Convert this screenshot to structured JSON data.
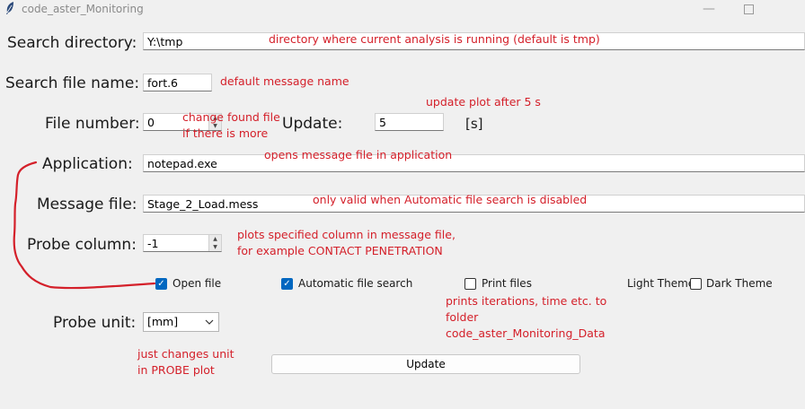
{
  "window": {
    "title": "code_aster_Monitoring"
  },
  "fields": {
    "search_directory": {
      "label": "Search directory:",
      "value": "Y:\\tmp"
    },
    "search_file_name": {
      "label": "Search file name:",
      "value": "fort.6"
    },
    "file_number": {
      "label": "File number:",
      "value": "0"
    },
    "update": {
      "label": "Update:",
      "value": "5",
      "unit": "[s]"
    },
    "application": {
      "label": "Application:",
      "value": "notepad.exe"
    },
    "message_file": {
      "label": "Message file:",
      "value": "Stage_2_Load.mess"
    },
    "probe_column": {
      "label": "Probe column:",
      "value": "-1"
    },
    "probe_unit": {
      "label": "Probe unit:",
      "value": "[mm]"
    }
  },
  "checkboxes": {
    "open_file": {
      "label": "Open file",
      "checked": true
    },
    "automatic_file_search": {
      "label": "Automatic file search",
      "checked": true
    },
    "print_files": {
      "label": "Print files",
      "checked": false
    },
    "dark_theme": {
      "label": "Dark Theme",
      "checked": false
    }
  },
  "light_theme_label": "Light Theme",
  "update_button": "Update",
  "annotations": {
    "directory": "directory where current analysis is running (default is tmp)",
    "default_message": "default message name",
    "update_plot": "update plot after 5 s",
    "change_found_1": "change found file",
    "change_found_2": "if there is more",
    "opens_message": "opens message file in application",
    "only_valid": "only valid when Automatic file search is disabled",
    "plots_1": "plots specified column in message file,",
    "plots_2": "for example CONTACT PENETRATION",
    "prints_1": "prints iterations, time etc. to",
    "prints_2": "folder",
    "prints_3": "code_aster_Monitoring_Data",
    "unit_1": "just changes unit",
    "unit_2": "in PROBE plot"
  },
  "colors": {
    "annotation": "#d4202a",
    "checkbox_checked": "#0067c0"
  },
  "icons": [
    "feather-icon",
    "minimize-icon",
    "maximize-icon",
    "check-icon",
    "chevron-down-icon",
    "spin-up-icon",
    "spin-down-icon"
  ]
}
